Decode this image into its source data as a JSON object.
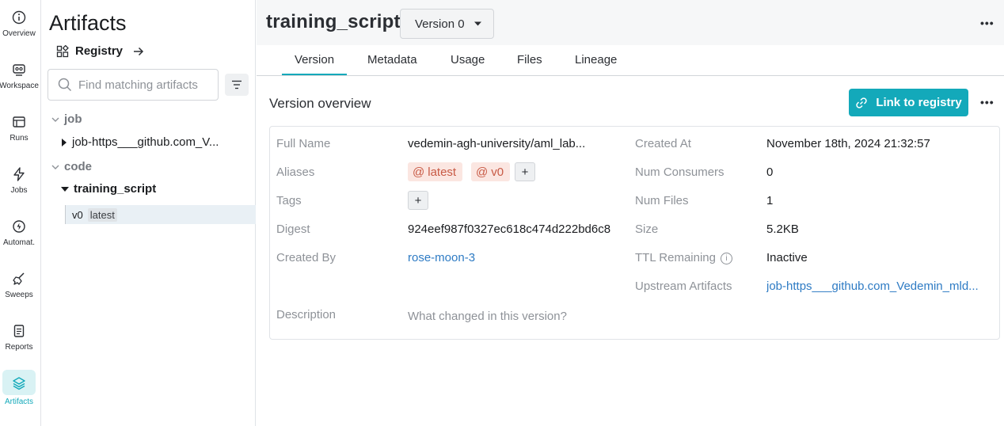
{
  "nav": {
    "items": [
      {
        "label": "Overview",
        "icon": "info-icon"
      },
      {
        "label": "Workspace",
        "icon": "workspace-icon"
      },
      {
        "label": "Runs",
        "icon": "runs-icon"
      },
      {
        "label": "Jobs",
        "icon": "lightning-icon"
      },
      {
        "label": "Automat.",
        "icon": "automation-icon"
      },
      {
        "label": "Sweeps",
        "icon": "broom-icon"
      },
      {
        "label": "Reports",
        "icon": "report-icon"
      },
      {
        "label": "Artifacts",
        "icon": "layers-icon",
        "active": true
      }
    ],
    "accent": "#13a9ba"
  },
  "tree": {
    "title": "Artifacts",
    "registry_label": "Registry",
    "search_placeholder": "Find matching artifacts",
    "groups": [
      {
        "name": "job",
        "items": [
          "job-https___github.com_V..."
        ]
      },
      {
        "name": "code",
        "items": [
          "training_script"
        ]
      }
    ],
    "selected_version": {
      "version": "v0",
      "alias": "latest"
    }
  },
  "main": {
    "title": "training_script",
    "version_select": "Version 0",
    "tabs": [
      "Version",
      "Metadata",
      "Usage",
      "Files",
      "Lineage"
    ],
    "active_tab": "Version",
    "section_title": "Version overview",
    "link_button": "Link to registry",
    "fields_left": {
      "full_name_label": "Full Name",
      "full_name": "vedemin-agh-university/aml_lab...",
      "aliases_label": "Aliases",
      "aliases": [
        "latest",
        "v0"
      ],
      "tags_label": "Tags",
      "digest_label": "Digest",
      "digest": "924eef987f0327ec618c474d222bd6c8",
      "created_by_label": "Created By",
      "created_by": "rose-moon-3",
      "description_label": "Description",
      "description_placeholder": "What changed in this version?"
    },
    "fields_right": {
      "created_at_label": "Created At",
      "created_at": "November 18th, 2024 21:32:57",
      "num_consumers_label": "Num Consumers",
      "num_consumers": "0",
      "num_files_label": "Num Files",
      "num_files": "1",
      "size_label": "Size",
      "size": "5.2KB",
      "ttl_label": "TTL Remaining",
      "ttl": "Inactive",
      "upstream_label": "Upstream Artifacts",
      "upstream": "job-https___github.com_Vedemin_mld..."
    },
    "plus": "+",
    "at_symbol": "@"
  }
}
